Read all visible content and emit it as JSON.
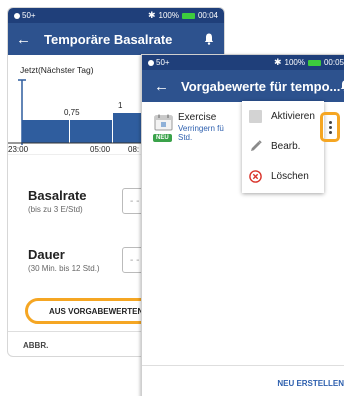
{
  "back_screen": {
    "status": {
      "left": "50+",
      "battery": "100%",
      "time": "00:04"
    },
    "title": "Temporäre Basalrate",
    "chart": {
      "header": "Jetzt(Nächster Tag)",
      "segment_value_1": "0,75",
      "segment_value_2": "1",
      "ticks": [
        "23:00",
        "05:00",
        "08:"
      ]
    },
    "basalrate": {
      "label": "Basalrate",
      "hint": "(bis zu 3 E/Std)",
      "value": "- -"
    },
    "dauer": {
      "label": "Dauer",
      "hint": "(30 Min. bis 12 Std.)",
      "value": "- -"
    },
    "presets_button": "AUS VORGABEWERTEN",
    "cancel_button": "ABBR."
  },
  "front_screen": {
    "status": {
      "left": "50+",
      "battery": "100%",
      "time": "00:05"
    },
    "title": "Vorgabewerte für tempo...",
    "preset": {
      "name": "Exercise",
      "desc_line1": "Verringern fü",
      "desc_line2": "Std.",
      "badge": "NEU",
      "icon": "calendar-icon"
    },
    "menu": [
      {
        "label": "Aktivieren",
        "icon": "checkbox-icon"
      },
      {
        "label": "Bearb.",
        "icon": "pencil-icon"
      },
      {
        "label": "Löschen",
        "icon": "delete-circle-icon"
      }
    ],
    "create_button": "NEU ERSTELLEN"
  },
  "colors": {
    "header_dark": "#1f3f7a",
    "header": "#2d528e",
    "highlight": "#f5a623",
    "badge_green": "#3aa24a",
    "link_blue": "#2d5fae",
    "delete_red": "#d9342b"
  }
}
